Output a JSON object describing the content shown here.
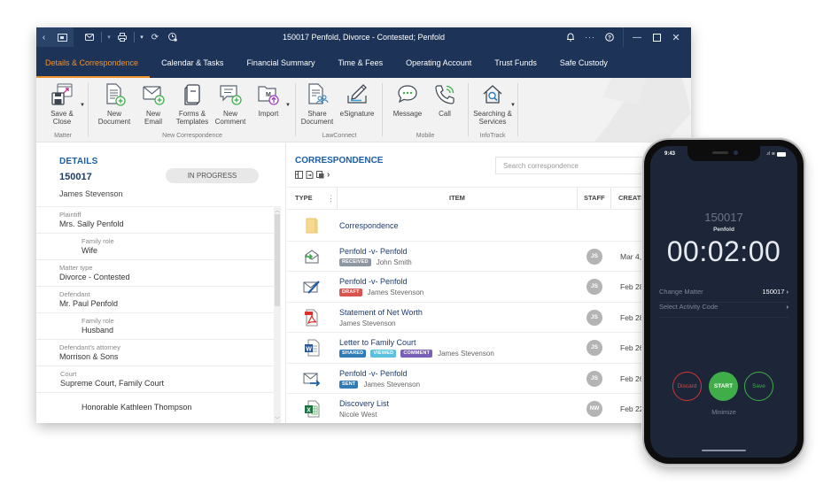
{
  "window": {
    "title": "150017 Penfold, Divorce - Contested; Penfold"
  },
  "titlebar_icons": {
    "left": [
      "back-icon",
      "folder-icon",
      "mail-icon",
      "print-icon",
      "refresh-icon",
      "time-icon"
    ],
    "right": [
      "bell-icon",
      "more-icon",
      "help-icon",
      "minimize-icon",
      "maximize-icon",
      "close-icon"
    ]
  },
  "tabs": [
    {
      "label": "Details & Correspondence",
      "active": true
    },
    {
      "label": "Calendar & Tasks",
      "active": false
    },
    {
      "label": "Financial Summary",
      "active": false
    },
    {
      "label": "Time & Fees",
      "active": false
    },
    {
      "label": "Operating Account",
      "active": false
    },
    {
      "label": "Trust Funds",
      "active": false
    },
    {
      "label": "Safe Custody",
      "active": false
    }
  ],
  "ribbon": {
    "groups": {
      "matter": "Matter",
      "new_correspondence": "New Correspondence",
      "lawconnect": "LawConnect",
      "mobile": "Mobile",
      "infotrack": "InfoTrack"
    },
    "buttons": {
      "save_close": "Save &\nClose",
      "new_document": "New\nDocument",
      "new_email": "New\nEmail",
      "forms_templates": "Forms &\nTemplates",
      "new_comment": "New\nComment",
      "import": "Import",
      "share_document": "Share\nDocument",
      "esignature": "eSignature",
      "message": "Message",
      "call": "Call",
      "searching_services": "Searching &\nServices"
    }
  },
  "details": {
    "heading": "DETAILS",
    "matter_number": "150017",
    "owner": "James Stevenson",
    "status": "IN PROGRESS",
    "fields": [
      {
        "label": "Plaintiff",
        "value": "Mrs. Sally Penfold",
        "indent": false
      },
      {
        "label": "Family role",
        "value": "Wife",
        "indent": true
      },
      {
        "label": "Matter type",
        "value": "Divorce - Contested",
        "indent": false
      },
      {
        "label": "Defendant",
        "value": "Mr. Paul Penfold",
        "indent": false
      },
      {
        "label": "Family role",
        "value": "Husband",
        "indent": true
      },
      {
        "label": "Defendant's attorney",
        "value": "Morrison & Sons",
        "indent": false
      },
      {
        "label": "Court",
        "value": "Supreme Court, Family Court",
        "indent": false
      },
      {
        "label": "",
        "value": "Honorable Kathleen Thompson",
        "indent": true
      }
    ]
  },
  "correspondence": {
    "heading": "CORRESPONDENCE",
    "search_placeholder": "Search correspondence",
    "columns": {
      "type": "TYPE",
      "item": "ITEM",
      "staff": "STAFF",
      "created": "CREATE"
    },
    "rows": [
      {
        "icon": "folder-icon",
        "title": "Correspondence",
        "badges": [],
        "person": "",
        "staff": "",
        "date": ""
      },
      {
        "icon": "received-email-icon",
        "title": "Penfold -v- Penfold",
        "badges": [
          {
            "text": "RECEIVED",
            "color": "#8e96a3"
          }
        ],
        "person": "John Smith",
        "staff": "JS",
        "date": "Mar 4,"
      },
      {
        "icon": "draft-email-icon",
        "title": "Penfold -v- Penfold",
        "badges": [
          {
            "text": "DRAFT",
            "color": "#d9534f"
          }
        ],
        "person": "James Stevenson",
        "staff": "JS",
        "date": "Feb 28,"
      },
      {
        "icon": "pdf-icon",
        "title": "Statement of Net Worth",
        "badges": [],
        "person": "James Stevenson",
        "staff": "JS",
        "date": "Feb 28,"
      },
      {
        "icon": "word-icon",
        "title": "Letter to Family Court",
        "badges": [
          {
            "text": "SHARED",
            "color": "#2f7bb8"
          },
          {
            "text": "VIEWED",
            "color": "#5bc0de"
          },
          {
            "text": "COMMENT",
            "color": "#7a5fb8"
          }
        ],
        "person": "James Stevenson",
        "staff": "JS",
        "date": "Feb 26,"
      },
      {
        "icon": "sent-email-icon",
        "title": "Penfold -v- Penfold",
        "badges": [
          {
            "text": "SENT",
            "color": "#2f7bb8"
          }
        ],
        "person": "James Stevenson",
        "staff": "JS",
        "date": "Feb 26,"
      },
      {
        "icon": "excel-icon",
        "title": "Discovery List",
        "badges": [],
        "person": "Nicole West",
        "staff": "NW",
        "date": "Feb 22,"
      }
    ]
  },
  "phone": {
    "status_time": "9:43",
    "matter_number": "150017",
    "client": "Penfold",
    "timer": "00:02:00",
    "change_matter_label": "Change Matter",
    "change_matter_value": "150017",
    "activity_label": "Select Activity Code",
    "discard": "Discard",
    "start": "START",
    "save": "Save",
    "minimize": "Minimize"
  },
  "colors": {
    "titlebar": "#1d3458",
    "active_tab": "#f0922b",
    "heading_blue": "#1a5ea8",
    "phone_bg": "#1c2638",
    "start_green": "#3fae49",
    "discard_red": "#d63333"
  }
}
